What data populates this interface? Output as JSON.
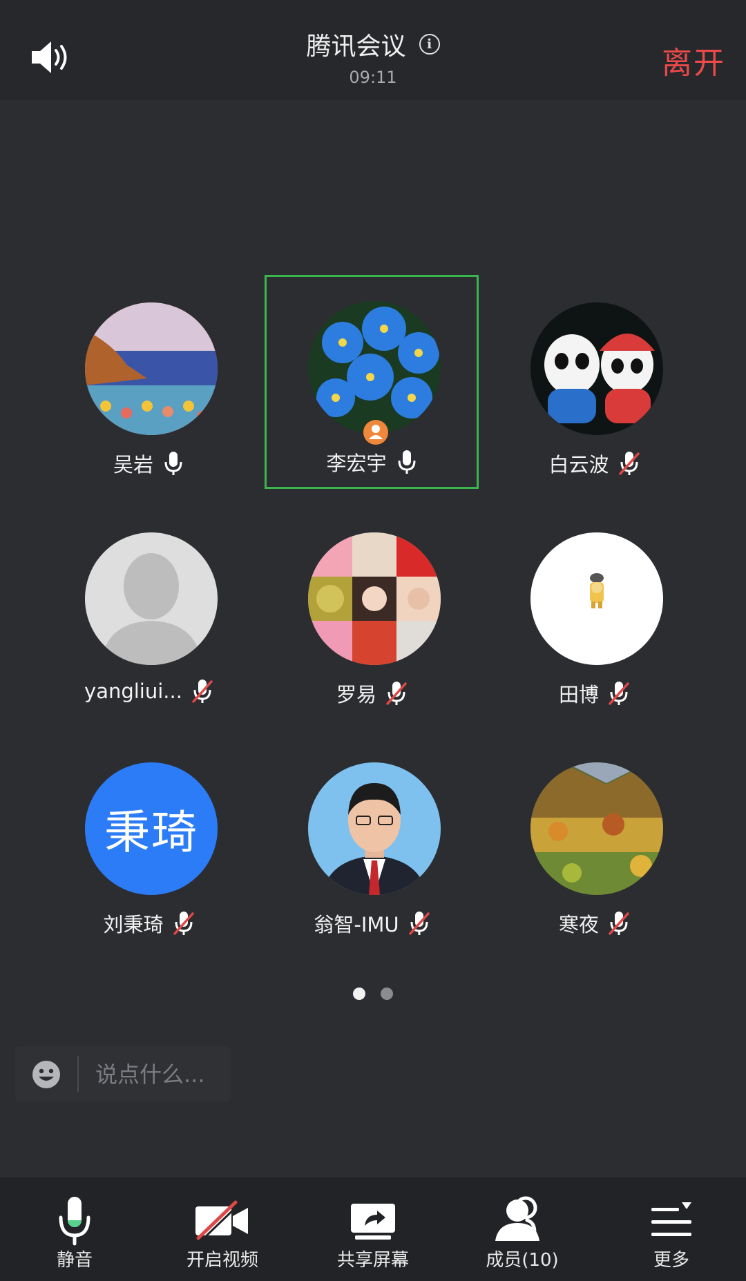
{
  "header": {
    "title": "腾讯会议",
    "time": "09:11",
    "leave_label": "离开"
  },
  "colors": {
    "leave": "#ec4a4a",
    "active_border": "#3bb64e",
    "host_badge": "#f0883b",
    "mic_on": "#56d28c",
    "muted_slash": "#e04848"
  },
  "participants": [
    {
      "name": "吴岩",
      "mic": "on",
      "avatar": "seaside-cliff-painting"
    },
    {
      "name": "李宏宇",
      "mic": "on",
      "avatar": "blue-flowers",
      "host": true,
      "active": true
    },
    {
      "name": "白云波",
      "mic": "muted",
      "avatar": "panda-mascots"
    },
    {
      "name": "yangliui...",
      "mic": "muted",
      "avatar": "default-silhouette"
    },
    {
      "name": "罗易",
      "mic": "muted",
      "avatar": "photo-collage"
    },
    {
      "name": "田博",
      "mic": "muted",
      "avatar": "small-cartoon-figure"
    },
    {
      "name": "刘秉琦",
      "mic": "muted",
      "avatar": "text-avatar",
      "avatar_text": "秉琦"
    },
    {
      "name": "翁智-IMU",
      "mic": "muted",
      "avatar": "portrait-photo"
    },
    {
      "name": "寒夜",
      "mic": "muted",
      "avatar": "autumn-forest"
    }
  ],
  "pager": {
    "pages": 2,
    "current": 1
  },
  "chat": {
    "placeholder": "说点什么..."
  },
  "toolbar": {
    "mute_label": "静音",
    "video_label": "开启视频",
    "share_label": "共享屏幕",
    "members_label": "成员(10)",
    "more_label": "更多"
  }
}
